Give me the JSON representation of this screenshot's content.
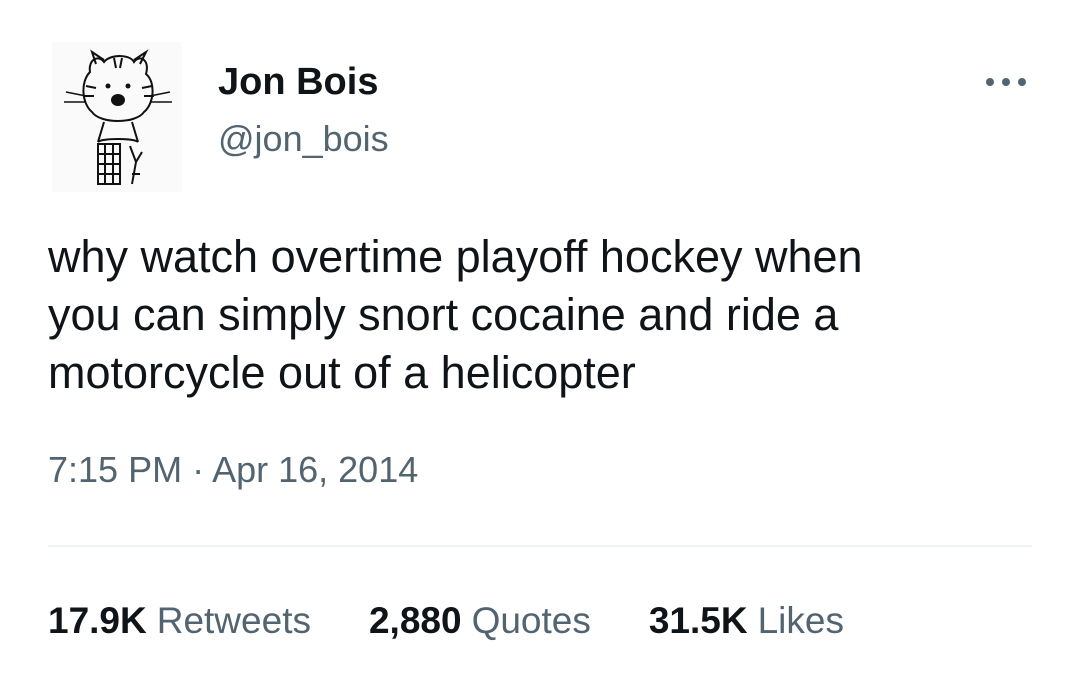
{
  "tweet": {
    "author": {
      "display_name": "Jon Bois",
      "handle": "@jon_bois",
      "avatar_icon": "hobbes-tiger-avatar"
    },
    "more_icon": "more-horizontal-icon",
    "text": "why watch overtime playoff hockey when\nyou can simply snort cocaine and ride a\nmotorcycle out of a helicopter",
    "timestamp": "7:15 PM · Apr 16, 2014",
    "stats": {
      "retweets": {
        "count": "17.9K",
        "label": "Retweets"
      },
      "quotes": {
        "count": "2,880",
        "label": "Quotes"
      },
      "likes": {
        "count": "31.5K",
        "label": "Likes"
      }
    },
    "colors": {
      "primary_text": "#0f1419",
      "secondary_text": "#536471",
      "divider": "#eff3f4"
    }
  }
}
